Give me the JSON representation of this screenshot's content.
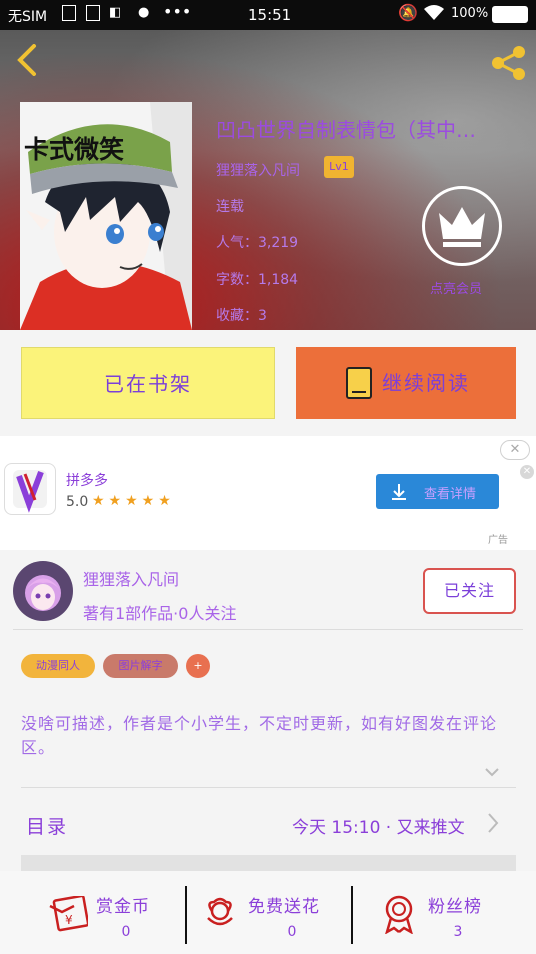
{
  "status_bar": {
    "carrier": "无SIM",
    "time": "15:51",
    "battery": "100%"
  },
  "header": {
    "back_icon": "chevron-left-icon",
    "share_icon": "share-icon"
  },
  "book": {
    "title": "凹凸世界自制表情包（其中…",
    "author": "狸狸落入凡间",
    "level": "Lv1",
    "status": "连载",
    "popularity": "人气：3,219",
    "word_count": "字数：1,184",
    "collection": "收藏：3",
    "cover_banner": "卡式微笑"
  },
  "vip": {
    "label": "点亮会员",
    "icon": "crown-icon"
  },
  "actions": {
    "shelf_label": "已在书架",
    "read_label": "继续阅读",
    "read_icon": "book-icon"
  },
  "ad": {
    "app_name": "拼多多",
    "rating": "5.0",
    "stars": "★★★★★",
    "cta_label": "查看详情",
    "tag": "广告",
    "close": "✕"
  },
  "author_section": {
    "name": "狸狸落入凡间",
    "stats": "著有1部作品·0人关注",
    "follow_label": "已关注"
  },
  "tags": [
    "动漫同人",
    "图片解字",
    "+"
  ],
  "description": "没啥可描述，作者是个小学生，不定时更新，如有好图发在评论区。",
  "toc": {
    "label": "目录",
    "latest": "今天 15:10 · 又来推文"
  },
  "bottom_bar": [
    {
      "label": "赏金币",
      "value": "0",
      "icon": "red-envelope-icon"
    },
    {
      "label": "免费送花",
      "value": "0",
      "icon": "flower-icon"
    },
    {
      "label": "粉丝榜",
      "value": "3",
      "icon": "medal-icon"
    }
  ],
  "colors": {
    "accent_purple": "#8b3fd9",
    "shelf_yellow": "#fbf37a",
    "read_orange": "#ec6f3a",
    "ad_blue": "#2a88d8",
    "follow_red": "#d9534f"
  }
}
